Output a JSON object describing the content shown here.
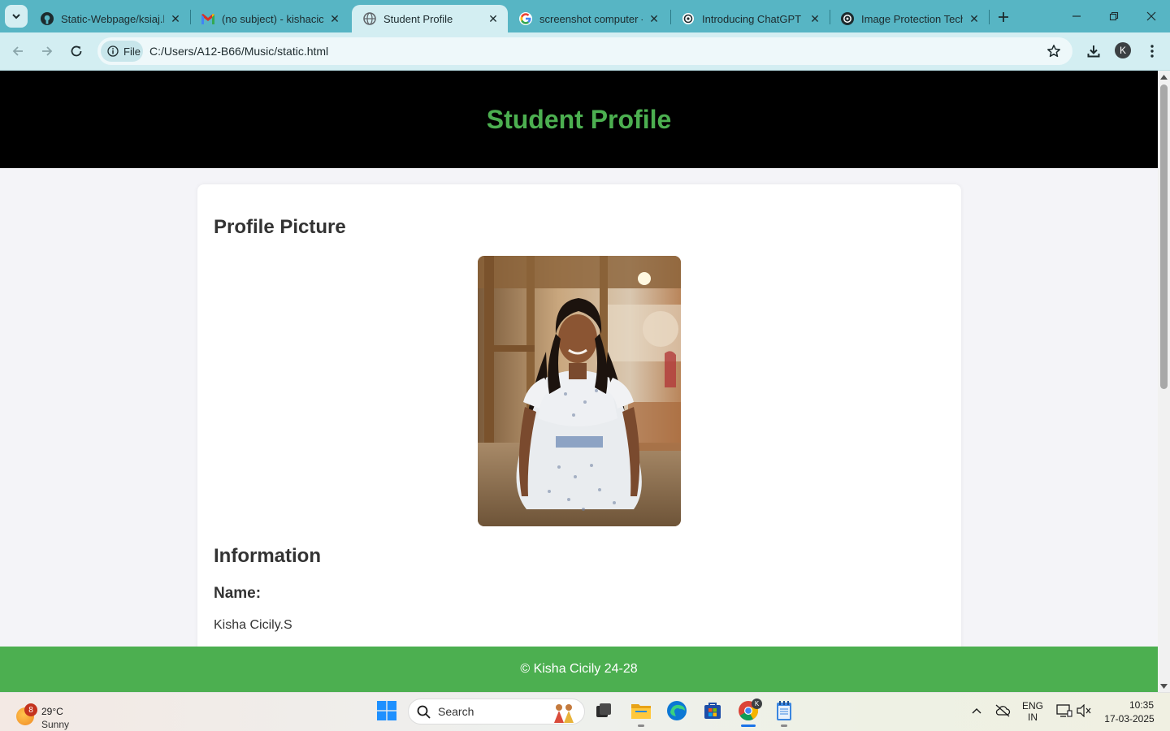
{
  "browser": {
    "tabs": [
      {
        "title": "Static-Webpage/ksiaj.ht",
        "icon": "github-icon"
      },
      {
        "title": "(no subject) - kishacicily",
        "icon": "gmail-icon"
      },
      {
        "title": "Student Profile",
        "icon": "globe-icon",
        "active": true
      },
      {
        "title": "screenshot computer - G",
        "icon": "google-icon"
      },
      {
        "title": "Introducing ChatGPT | C",
        "icon": "openai-icon"
      },
      {
        "title": "Image Protection Techn",
        "icon": "openai-icon"
      }
    ],
    "chip_label": "File",
    "url": "C:/Users/A12-B66/Music/static.html",
    "profile_initial": "K"
  },
  "page": {
    "header_title": "Student Profile",
    "profile_picture_heading": "Profile Picture",
    "information_heading": "Information",
    "name_label": "Name:",
    "name_value": "Kisha Cicily.S",
    "footer_text": "© Kisha Cicily 24-28"
  },
  "colors": {
    "accent": "#4caf50",
    "header_bg": "#000000",
    "tabbar": "#57b5c4"
  },
  "taskbar": {
    "weather_badge": "8",
    "temperature": "29°C",
    "condition": "Sunny",
    "search_placeholder": "Search",
    "language": "ENG",
    "region": "IN",
    "time": "10:35",
    "date": "17-03-2025"
  }
}
